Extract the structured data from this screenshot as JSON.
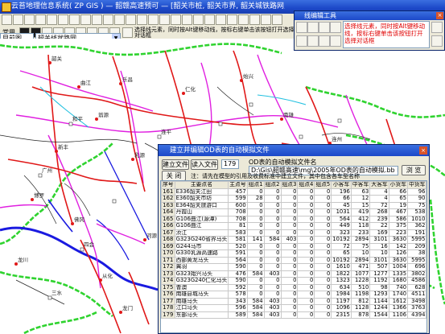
{
  "window": {
    "title": "云苔地理信息系统( ZP GIS ) — 韶赣高速预可 — [韶关市桩, 韶关市界, 韶关城铁路网, 韶关市县点, 韶关镇点]"
  },
  "toolbar": {
    "menu_label": "常用",
    "layer_combo": "目前图",
    "map_combo": "韶关线状路网",
    "hint": "选择线元素，同时按Alt键移动线，按标右键单击该按钮打开选择对话框"
  },
  "edit_palette": {
    "title": "线编辑工具",
    "info": "选择线元素，同时按Alt键移动线，按标右键单击该按钮打开选择对话框"
  },
  "map_labels": [
    {
      "text": "韶关"
    },
    {
      "text": "曲江"
    },
    {
      "text": "乐昌"
    },
    {
      "text": "仁化"
    },
    {
      "text": "始兴"
    },
    {
      "text": "南雄"
    },
    {
      "text": "翁源"
    },
    {
      "text": "新丰"
    },
    {
      "text": "乳源"
    },
    {
      "text": "英德"
    },
    {
      "text": "连南"
    },
    {
      "text": "连州"
    },
    {
      "text": "阳山"
    },
    {
      "text": "清远"
    },
    {
      "text": "佛冈"
    },
    {
      "text": "从化"
    },
    {
      "text": "龙门"
    },
    {
      "text": "博罗"
    },
    {
      "text": "河源"
    },
    {
      "text": "龙川"
    },
    {
      "text": "和平"
    },
    {
      "text": "连平"
    },
    {
      "text": "广州"
    },
    {
      "text": "四会"
    },
    {
      "text": "三水"
    }
  ],
  "dialog": {
    "title": "建立并编辑OD表的自动模拟文件",
    "build_button": "建立文件",
    "read_button": "读入文件",
    "spin_value": "179",
    "close_button": "关  闭",
    "file_label": "OD表的自动模拟文件名",
    "file_path": "D:\\Gis\\韶赣高速\\mg\\2005年OD表的自动模拟.bb DAT",
    "browse_button": "浏  览",
    "note_label": "注：请先在模型的引用及收费标准中建立文件，其中包含各车型名称",
    "columns": [
      "序号",
      "主要点名",
      "主点号",
      "组点1",
      "组点2",
      "组点3",
      "组点4",
      "组点5",
      "小客车",
      "中客车",
      "大客车",
      "小货车",
      "中货车",
      "大货车",
      "特大货"
    ],
    "rows": [
      [
        "161",
        "E336韶关江田",
        "457",
        "0",
        "0",
        "0",
        "0",
        "0",
        "196",
        "63",
        "4",
        "66",
        "96",
        "5",
        "5"
      ],
      [
        "162",
        "E360韶关市坊",
        "599",
        "28",
        "0",
        "0",
        "0",
        "0",
        "66",
        "12",
        "4",
        "65",
        "90",
        "5",
        "5"
      ],
      [
        "163",
        "E364韶关旅游口",
        "600",
        "0",
        "0",
        "0",
        "0",
        "0",
        "45",
        "15",
        "72",
        "19",
        "75",
        "2",
        "1"
      ],
      [
        "164",
        "丹霞山",
        "708",
        "0",
        "0",
        "0",
        "0",
        "0",
        "1031",
        "419",
        "268",
        "467",
        "538",
        "169",
        "80"
      ],
      [
        "165",
        "G106曲江(源潭)",
        "708",
        "0",
        "0",
        "0",
        "0",
        "0",
        "564",
        "412",
        "239",
        "586",
        "1010",
        "110",
        "26"
      ],
      [
        "166",
        "G106曲江",
        "81",
        "0",
        "0",
        "0",
        "0",
        "0",
        "449",
        "118",
        "22",
        "375",
        "362",
        "15",
        "4"
      ],
      [
        "167",
        "浈江",
        "583",
        "0",
        "0",
        "0",
        "0",
        "0",
        "323",
        "233",
        "169",
        "223",
        "191",
        "218",
        "4"
      ],
      [
        "168",
        "G323G240省界马头",
        "581",
        "141",
        "584",
        "403",
        "0",
        "0",
        "10192",
        "2894",
        "3101",
        "3630",
        "5995",
        "2870",
        "1088"
      ],
      [
        "169",
        "G244马市",
        "520",
        "0",
        "0",
        "0",
        "0",
        "0",
        "72",
        "75",
        "16",
        "142",
        "209",
        "12",
        "2"
      ],
      [
        "170",
        "G330乳源高速路",
        "591",
        "0",
        "0",
        "0",
        "0",
        "0",
        "65",
        "10",
        "10",
        "126",
        "38",
        "0",
        "0"
      ],
      [
        "171",
        "西部黄龙马头",
        "564",
        "0",
        "0",
        "0",
        "0",
        "0",
        "10192",
        "2894",
        "3101",
        "3630",
        "5995",
        "2870",
        "1088"
      ],
      [
        "172",
        "翼羽",
        "590",
        "0",
        "0",
        "0",
        "0",
        "0",
        "1610",
        "471",
        "507",
        "1004",
        "696",
        "76",
        "32"
      ],
      [
        "173",
        "G323始兴马头",
        "476",
        "584",
        "403",
        "0",
        "0",
        "0",
        "1822",
        "1077",
        "1277",
        "1335",
        "3802",
        "1506",
        "1006"
      ],
      [
        "174",
        "G323G240仁化马头",
        "590",
        "0",
        "0",
        "0",
        "0",
        "0",
        "1323",
        "1228",
        "1192",
        "1680",
        "4586",
        "1966",
        "425"
      ],
      [
        "175",
        "曹澳",
        "592",
        "0",
        "0",
        "0",
        "0",
        "0",
        "634",
        "510",
        "98",
        "740",
        "628",
        "593",
        "0"
      ],
      [
        "176",
        "南雄县城马头",
        "578",
        "0",
        "0",
        "0",
        "0",
        "0",
        "1984",
        "1198",
        "1293",
        "1740",
        "4511",
        "1966",
        "1162"
      ],
      [
        "177",
        "南雄马头",
        "343",
        "584",
        "403",
        "0",
        "0",
        "0",
        "1197",
        "812",
        "1144",
        "1612",
        "3498",
        "1547",
        "944"
      ],
      [
        "178",
        "江口马头",
        "596",
        "584",
        "403",
        "0",
        "0",
        "0",
        "1096",
        "1128",
        "1244",
        "1366",
        "3763",
        "1740",
        "1003"
      ],
      [
        "179",
        "东部马头",
        "589",
        "584",
        "403",
        "0",
        "0",
        "0",
        "2315",
        "878",
        "1544",
        "1106",
        "4394",
        "1612",
        "1153"
      ]
    ]
  }
}
